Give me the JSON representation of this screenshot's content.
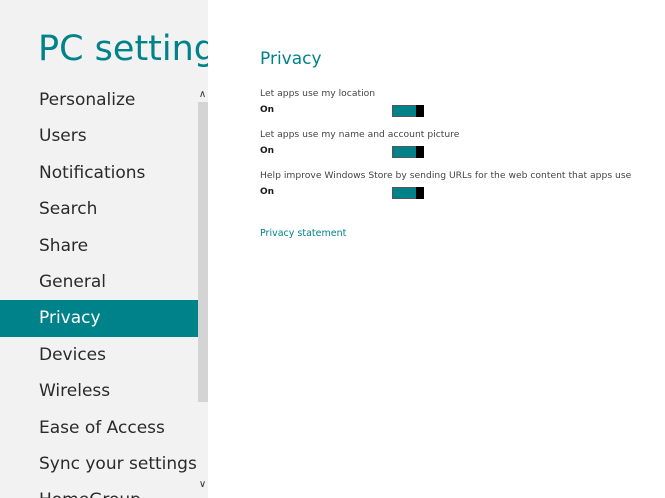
{
  "app": {
    "title": "PC settings"
  },
  "sidebar": {
    "items": [
      {
        "label": "Personalize",
        "selected": false
      },
      {
        "label": "Users",
        "selected": false
      },
      {
        "label": "Notifications",
        "selected": false
      },
      {
        "label": "Search",
        "selected": false
      },
      {
        "label": "Share",
        "selected": false
      },
      {
        "label": "General",
        "selected": false
      },
      {
        "label": "Privacy",
        "selected": true
      },
      {
        "label": "Devices",
        "selected": false
      },
      {
        "label": "Wireless",
        "selected": false
      },
      {
        "label": "Ease of Access",
        "selected": false
      },
      {
        "label": "Sync your settings",
        "selected": false
      },
      {
        "label": "HomeGroup",
        "selected": false
      }
    ],
    "scroll_up_icon": "chevron-up-icon",
    "scroll_down_icon": "chevron-down-icon"
  },
  "main": {
    "section_title": "Privacy",
    "settings": [
      {
        "label": "Let apps use my location",
        "state": "On",
        "enabled": true
      },
      {
        "label": "Let apps use my name and account picture",
        "state": "On",
        "enabled": true
      },
      {
        "label": "Help improve Windows Store by sending URLs for the web content that apps use",
        "state": "On",
        "enabled": true
      }
    ],
    "link_label": "Privacy statement"
  },
  "colors": {
    "accent": "#00828a",
    "sidebar_bg": "#f2f2f2",
    "background": "#ffffff",
    "toggle_thumb": "#000000"
  }
}
